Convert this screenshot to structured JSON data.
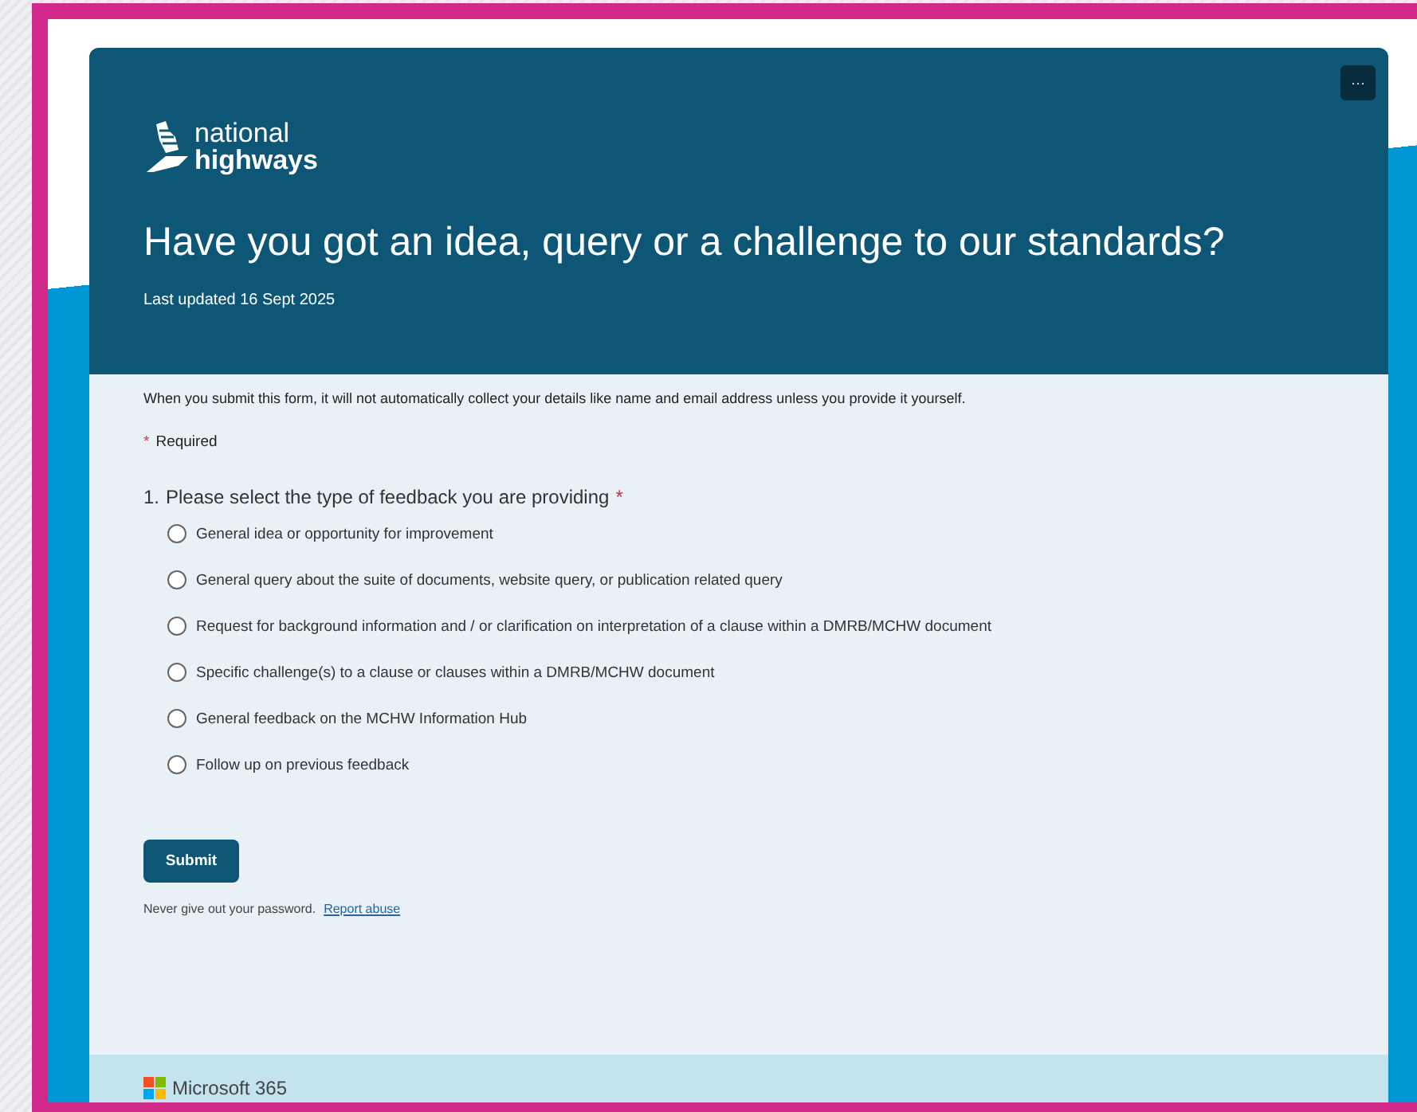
{
  "header": {
    "logo": {
      "line_1": "national",
      "line_2": "highways"
    },
    "title": "Have you got an idea, query or a challenge to our standards?",
    "subtitle": "Last updated 16 Sept 2025",
    "more_button": "···"
  },
  "privacy_notice": "When you submit this form, it will not automatically collect your details like name and email address unless you provide it yourself.",
  "required_note": {
    "mark": "*",
    "label": "Required"
  },
  "question": {
    "number": "1.",
    "text": "Please select the type of feedback you are providing",
    "required_mark": "*",
    "options": [
      {
        "label": "General idea or opportunity for improvement",
        "selected": false
      },
      {
        "label": "General query about the suite of documents, website query, or publication related query",
        "selected": false
      },
      {
        "label": "Request for background information and / or clarification on interpretation of a clause within a DMRB/MCHW document",
        "selected": false
      },
      {
        "label": "Specific challenge(s) to a clause or clauses within a DMRB/MCHW document",
        "selected": false
      },
      {
        "label": "General feedback on the MCHW Information Hub",
        "selected": false
      },
      {
        "label": "Follow up on previous feedback",
        "selected": false
      }
    ]
  },
  "submit_button": "Submit",
  "footer_note": {
    "text": "Never give out your password.",
    "link": "Report abuse"
  },
  "brand_footer": "Microsoft 365"
}
